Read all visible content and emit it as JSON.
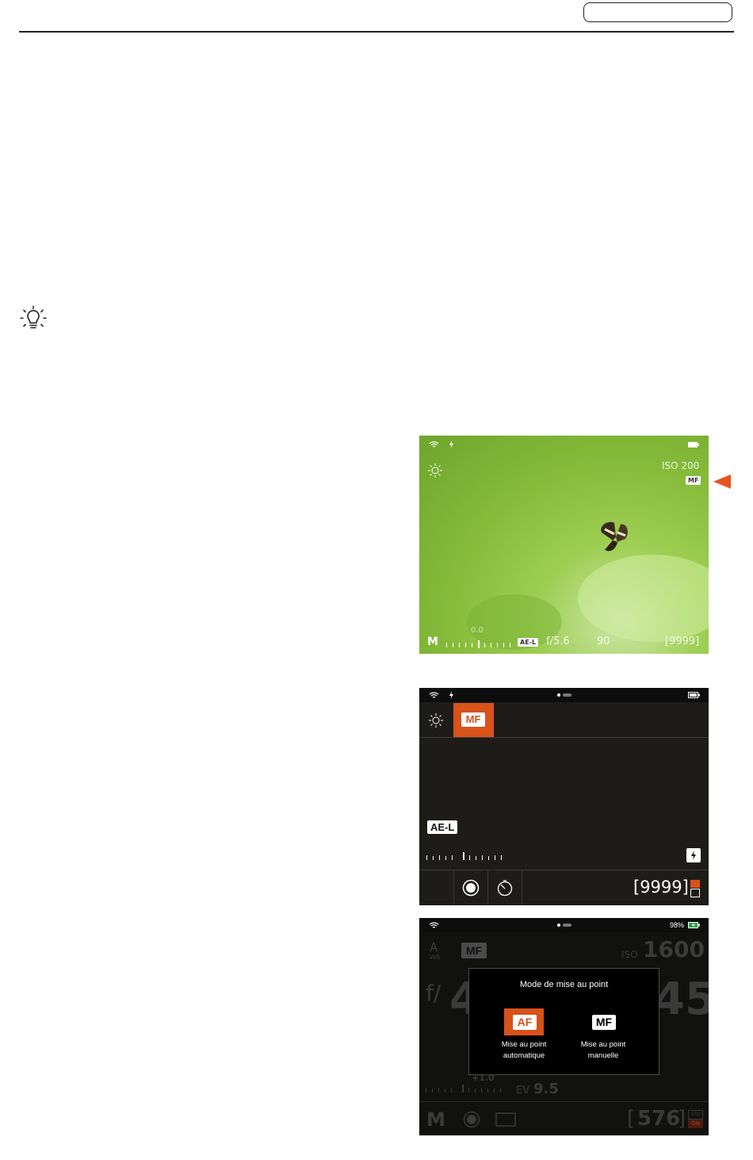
{
  "header": {
    "page_box_label": ""
  },
  "icons": {
    "tip": "lightbulb-icon"
  },
  "screen1": {
    "iso": "ISO 200",
    "focus_mode": "MF",
    "exposure_mode": "M",
    "exposure_comp": "0.0",
    "ael": "AE-L",
    "aperture": "f/5.6",
    "shutter": "90",
    "shots_remaining": "[9999]"
  },
  "screen2": {
    "focus_mode": "MF",
    "ael": "AE-L",
    "shots_remaining": "[9999]"
  },
  "screen3": {
    "wb_top": "A",
    "wb_bottom": "WB",
    "focus_mode": "MF",
    "iso_label": "ISO",
    "iso_value": "1600",
    "f_prefix": "f/",
    "aperture_partial": "4",
    "shutter_partial": "45",
    "ev_comp": "+1.0",
    "ev_label": "EV",
    "ev_value": "9.5",
    "exposure_mode": "M",
    "shots_remaining": "576",
    "storage_top": "SSD",
    "storage_bottom": "ON",
    "battery": "98%",
    "modal": {
      "title": "Mode de mise au point",
      "af_label": "AF",
      "af_caption_1": "Mise au point",
      "af_caption_2": "automatique",
      "mf_label": "MF",
      "mf_caption_1": "Mise au point",
      "mf_caption_2": "manuelle"
    }
  },
  "colors": {
    "accent": "#d8521a",
    "arrow": "#e8541e"
  }
}
